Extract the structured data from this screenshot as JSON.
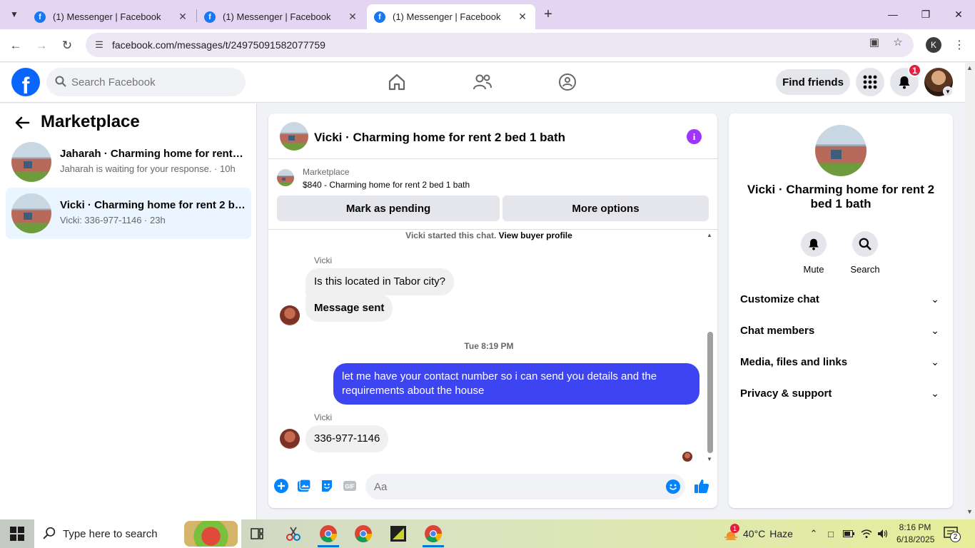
{
  "browser": {
    "tabs": [
      {
        "title": "(1) Messenger | Facebook"
      },
      {
        "title": "(1) Messenger | Facebook"
      },
      {
        "title": "(1) Messenger | Facebook"
      }
    ],
    "url": "facebook.com/messages/t/24975091582077759",
    "profile_initial": "K"
  },
  "fb_header": {
    "search_placeholder": "Search Facebook",
    "find_friends": "Find friends",
    "notification_count": "1"
  },
  "left_panel": {
    "title": "Marketplace",
    "conversations": [
      {
        "title": "Jaharah · Charming home for rent 2 bed 1 bath",
        "subtitle": "Jaharah is waiting for your response. · 10h",
        "active": false
      },
      {
        "title": "Vicki · Charming home for rent 2 bed 1 bath",
        "subtitle": "Vicki: 336-977-1146 · 23h",
        "active": true
      }
    ]
  },
  "chat": {
    "title": "Vicki · Charming home for rent 2 bed 1 bath",
    "listing_label": "Marketplace",
    "listing_desc": "$840 - Charming home for rent 2 bed 1 bath",
    "mark_pending": "Mark as pending",
    "more_options": "More options",
    "started_text": "Vicki started this chat.",
    "view_buyer_profile": "View buyer profile",
    "messages": [
      {
        "sender": "Vicki",
        "text": "Is this located in Tabor city?",
        "dir": "in"
      },
      {
        "text": "Message sent",
        "dir": "in"
      },
      {
        "timestamp": "Tue 8:19 PM"
      },
      {
        "text": "let me have your contact number so i can send you details and the requirements about the house",
        "dir": "out"
      },
      {
        "sender": "Vicki",
        "text": "336-977-1146",
        "dir": "in"
      }
    ],
    "composer_placeholder": "Aa"
  },
  "right_panel": {
    "title": "Vicki · Charming home for rent 2 bed 1 bath",
    "actions": [
      {
        "label": "Mute",
        "icon": "bell-icon"
      },
      {
        "label": "Search",
        "icon": "search-icon"
      }
    ],
    "sections": [
      {
        "label": "Customize chat"
      },
      {
        "label": "Chat members"
      },
      {
        "label": "Media, files and links"
      },
      {
        "label": "Privacy & support"
      }
    ]
  },
  "taskbar": {
    "search_text": "Type here to search",
    "weather_temp": "40°C",
    "weather_desc": "Haze",
    "weather_badge": "1",
    "time": "8:16 PM",
    "date": "6/18/2025",
    "notification_count": "2"
  },
  "colors": {
    "fb_blue": "#0866ff",
    "outgoing_bubble": "#3d45f2",
    "info_purple": "#a033ff",
    "active_conv": "#ebf5ff"
  }
}
